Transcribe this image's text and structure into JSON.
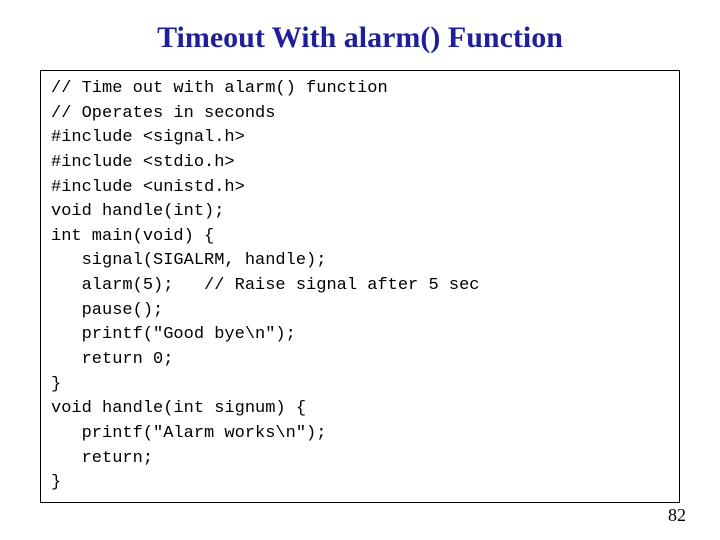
{
  "title": "Timeout With alarm() Function",
  "code": "// Time out with alarm() function\n// Operates in seconds\n#include <signal.h>\n#include <stdio.h>\n#include <unistd.h>\nvoid handle(int);\nint main(void) {\n   signal(SIGALRM, handle);\n   alarm(5);   // Raise signal after 5 sec\n   pause();\n   printf(\"Good bye\\n\");\n   return 0;\n}\nvoid handle(int signum) {\n   printf(\"Alarm works\\n\");\n   return;\n}",
  "page_number": "82"
}
